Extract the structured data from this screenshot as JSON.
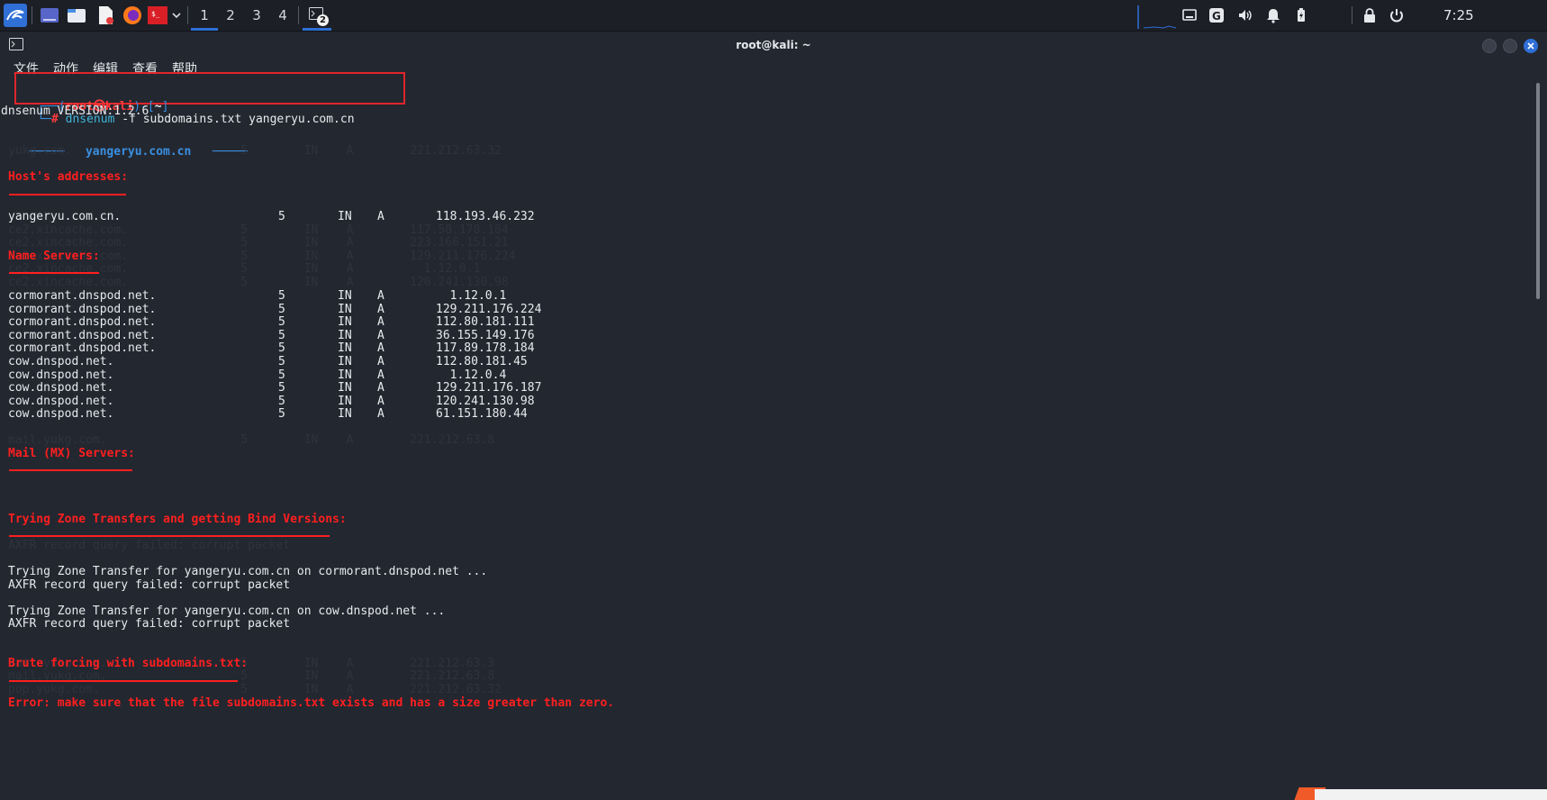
{
  "taskbar": {
    "workspaces": [
      "1",
      "2",
      "3",
      "4"
    ],
    "terminal_badge": "2",
    "clock": "7:25",
    "icons": [
      "kali-menu-icon",
      "files-icon",
      "file-manager-icon",
      "text-editor-icon",
      "firefox-icon",
      "terminal-launcher-icon",
      "chevron-down-icon"
    ]
  },
  "window": {
    "title": "root@kali: ~",
    "menu": [
      "文件",
      "动作",
      "编辑",
      "查看",
      "帮助"
    ]
  },
  "terminal": {
    "prompt_user": "root㉿kali",
    "prompt_dir": "~",
    "prompt_symbol": "#",
    "command": "dnsenum",
    "command_args": "-f subdomains.txt yangeryu.com.cn",
    "version": "dnsenum VERSION:1.2.6",
    "domain_banner": "yangeryu.com.cn",
    "sections": {
      "hosts": "Host's addresses:",
      "ns": "Name Servers:",
      "mx": "Mail (MX) Servers:",
      "zone": "Trying Zone Transfers and getting Bind Versions:",
      "brute": "Brute forcing with subdomains.txt:"
    },
    "host_records": [
      {
        "name": "yangeryu.com.cn.",
        "ttl": "5",
        "class": "IN",
        "type": "A",
        "ip": "118.193.46.232"
      }
    ],
    "ns_records": [
      {
        "name": "cormorant.dnspod.net.",
        "ttl": "5",
        "class": "IN",
        "type": "A",
        "ip": "  1.12.0.1"
      },
      {
        "name": "cormorant.dnspod.net.",
        "ttl": "5",
        "class": "IN",
        "type": "A",
        "ip": "129.211.176.224"
      },
      {
        "name": "cormorant.dnspod.net.",
        "ttl": "5",
        "class": "IN",
        "type": "A",
        "ip": "112.80.181.111"
      },
      {
        "name": "cormorant.dnspod.net.",
        "ttl": "5",
        "class": "IN",
        "type": "A",
        "ip": "36.155.149.176"
      },
      {
        "name": "cormorant.dnspod.net.",
        "ttl": "5",
        "class": "IN",
        "type": "A",
        "ip": "117.89.178.184"
      },
      {
        "name": "cow.dnspod.net.",
        "ttl": "5",
        "class": "IN",
        "type": "A",
        "ip": "112.80.181.45"
      },
      {
        "name": "cow.dnspod.net.",
        "ttl": "5",
        "class": "IN",
        "type": "A",
        "ip": "  1.12.0.4"
      },
      {
        "name": "cow.dnspod.net.",
        "ttl": "5",
        "class": "IN",
        "type": "A",
        "ip": "129.211.176.187"
      },
      {
        "name": "cow.dnspod.net.",
        "ttl": "5",
        "class": "IN",
        "type": "A",
        "ip": "120.241.130.98"
      },
      {
        "name": "cow.dnspod.net.",
        "ttl": "5",
        "class": "IN",
        "type": "A",
        "ip": "61.151.180.44"
      }
    ],
    "zone_lines": [
      "Trying Zone Transfer for yangeryu.com.cn on cormorant.dnspod.net ...",
      "AXFR record query failed: corrupt packet",
      "Trying Zone Transfer for yangeryu.com.cn on cow.dnspod.net ...",
      "AXFR record query failed: corrupt packet"
    ],
    "error": "Error: make sure that the file subdomains.txt exists and has a size greater than zero."
  },
  "colors": {
    "error_red": "#ff1f1f",
    "prompt_blue": "#3a8fe0",
    "highlight_box": "#e0252b",
    "terminal_bg": "#232730"
  }
}
